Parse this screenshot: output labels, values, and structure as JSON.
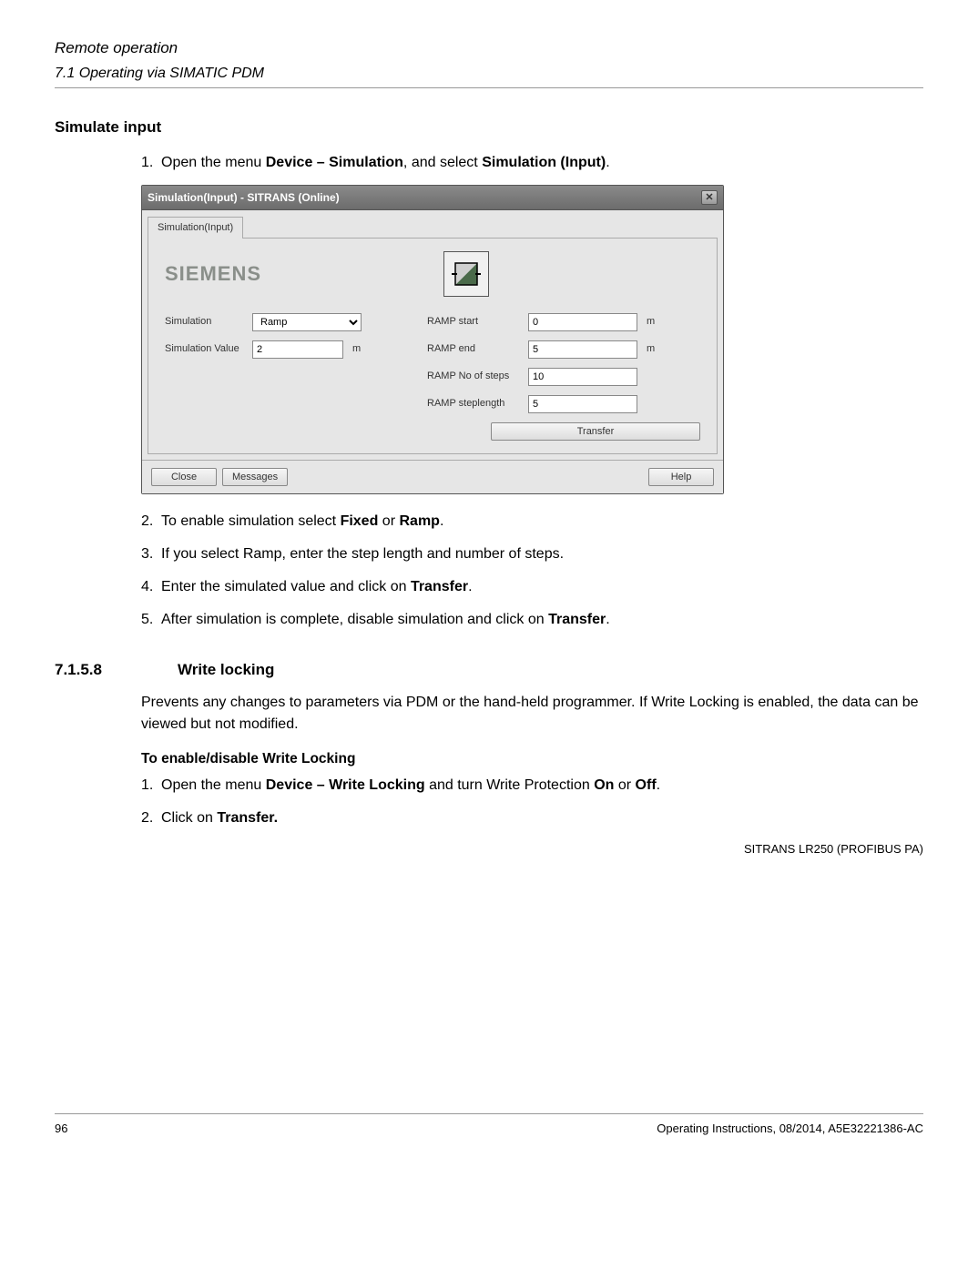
{
  "breadcrumb": "Remote operation",
  "breadcrumb_sub": "7.1 Operating via SIMATIC PDM",
  "section_title": "Simulate input",
  "step1_pre": "Open the menu ",
  "step1_b1": "Device – Simulation",
  "step1_mid": ", and select ",
  "step1_b2": "Simulation (Input)",
  "step1_post": ".",
  "dialog": {
    "title": "Simulation(Input) - SITRANS  (Online)",
    "tab": "Simulation(Input)",
    "brand": "SIEMENS",
    "sim_label": "Simulation",
    "sim_value_opt": "Ramp",
    "simval_label": "Simulation Value",
    "simval_value": "2",
    "ramp_start_label": "RAMP start",
    "ramp_start": "0",
    "ramp_end_label": "RAMP end",
    "ramp_end": "5",
    "ramp_steps_label": "RAMP No of steps",
    "ramp_steps": "10",
    "ramp_len_label": "RAMP steplength",
    "ramp_len": "5",
    "unit_m": "m",
    "transfer": "Transfer",
    "close": "Close",
    "messages": "Messages",
    "help": "Help"
  },
  "step2_pre": "To enable simulation select ",
  "step2_b1": "Fixed",
  "step2_or": " or ",
  "step2_b2": "Ramp",
  "step2_post": ".",
  "step3": "If you select Ramp, enter the step length and number of steps.",
  "step4_pre": "Enter the simulated value and click on ",
  "step4_b": "Transfer",
  "step4_post": ".",
  "step5_pre": "After simulation is complete, disable simulation and click on ",
  "step5_b": "Transfer",
  "step5_post": ".",
  "sec_num": "7.1.5.8",
  "sec_title": "Write locking",
  "para1": "Prevents any changes to parameters via PDM or the hand-held programmer. If Write Locking is enabled, the data can be viewed but not modified.",
  "subhead": "To enable/disable Write Locking",
  "wstep1_pre": "Open the menu ",
  "wstep1_b1": "Device – Write Locking",
  "wstep1_mid": " and turn Write Protection ",
  "wstep1_b2": "On",
  "wstep1_or": " or ",
  "wstep1_b3": "Off",
  "wstep1_post": ".",
  "wstep2_pre": "Click on ",
  "wstep2_b": "Transfer.",
  "footer_product": "SITRANS LR250 (PROFIBUS PA)",
  "footer_doc": "Operating Instructions, 08/2014, A5E32221386-AC",
  "page_num": "96"
}
